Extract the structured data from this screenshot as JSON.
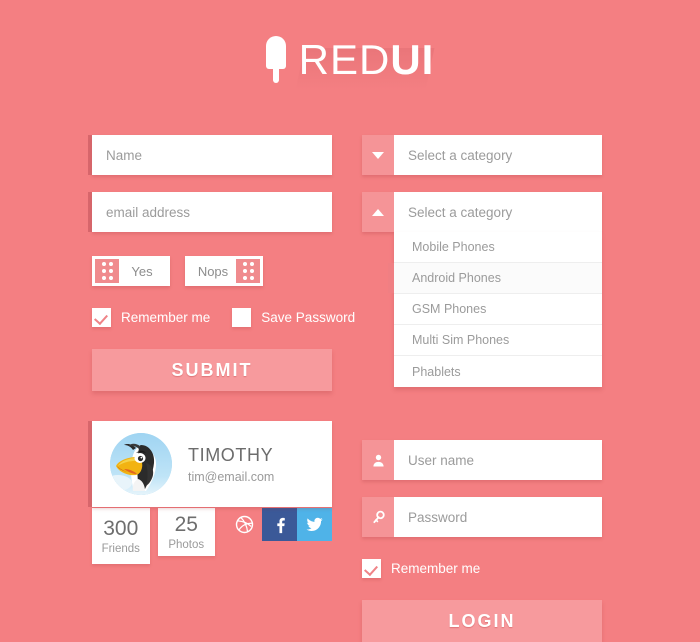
{
  "header": {
    "logo_icon": "popsicle-icon",
    "logo_text_light": "RED",
    "logo_text_bold": "UI"
  },
  "left_column": {
    "name_field": {
      "placeholder": "Name",
      "value": ""
    },
    "email_field": {
      "placeholder": "email address",
      "value": ""
    },
    "toggles": [
      {
        "label": "Yes",
        "state": "on"
      },
      {
        "label": "Nops",
        "state": "off"
      }
    ],
    "checkboxes": [
      {
        "label": "Remember me",
        "checked": true
      },
      {
        "label": "Save Password",
        "checked": false
      }
    ],
    "submit_label": "SUBMIT",
    "profile": {
      "avatar_icon": "toucan-avatar",
      "name": "TIMOTHY",
      "email": "tim@email.com",
      "stats": [
        {
          "value": "300",
          "label": "Friends"
        },
        {
          "value": "25",
          "label": "Photos"
        }
      ],
      "social": [
        {
          "name": "dribbble-icon",
          "color": "#f47f82"
        },
        {
          "name": "facebook-icon",
          "color": "#3b5998"
        },
        {
          "name": "twitter-icon",
          "color": "#4fb3e8"
        }
      ]
    }
  },
  "right_column": {
    "select_closed": {
      "value": "Select a category",
      "arrow": "chevron-down-icon"
    },
    "select_open": {
      "value": "Select a category",
      "arrow": "chevron-up-icon",
      "options": [
        {
          "label": "Mobile Phones",
          "active": false
        },
        {
          "label": "Android Phones",
          "active": true
        },
        {
          "label": "GSM Phones",
          "active": false
        },
        {
          "label": "Multi Sim Phones",
          "active": false
        },
        {
          "label": "Phablets",
          "active": false
        }
      ]
    },
    "username_field": {
      "placeholder": "User name",
      "value": "",
      "icon": "user-icon"
    },
    "password_field": {
      "placeholder": "Password",
      "value": "",
      "icon": "key-icon"
    },
    "remember_checkbox": {
      "label": "Remember me",
      "checked": true
    },
    "login_label": "LOGIN"
  },
  "colors": {
    "background": "#f47f82",
    "accent": "#f59497",
    "button": "#f79a9d",
    "facebook": "#3b5998",
    "twitter": "#4fb3e8"
  }
}
